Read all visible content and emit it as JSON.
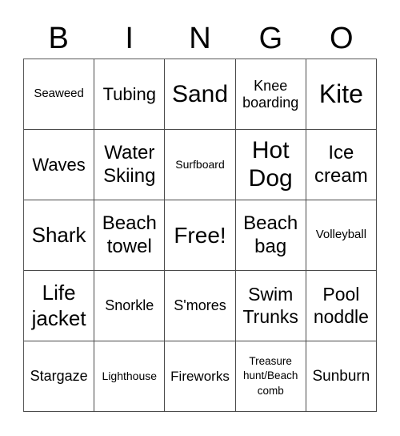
{
  "header": {
    "letters": [
      "B",
      "I",
      "N",
      "G",
      "O"
    ]
  },
  "grid": {
    "rows": [
      [
        "Seaweed",
        "Tubing",
        "Sand",
        "Knee boarding",
        "Kite"
      ],
      [
        "Waves",
        "Water Skiing",
        "Surfboard",
        "Hot Dog",
        "Ice cream"
      ],
      [
        "Shark",
        "Beach towel",
        "Free!",
        "Beach bag",
        "Volleyball"
      ],
      [
        "Life jacket",
        "Snorkle",
        "S'mores",
        "Swim Trunks",
        "Pool noddle"
      ],
      [
        "Stargaze",
        "Lighthouse",
        "Fireworks",
        "Treasure hunt/Beach comb",
        "Sunburn"
      ]
    ]
  }
}
